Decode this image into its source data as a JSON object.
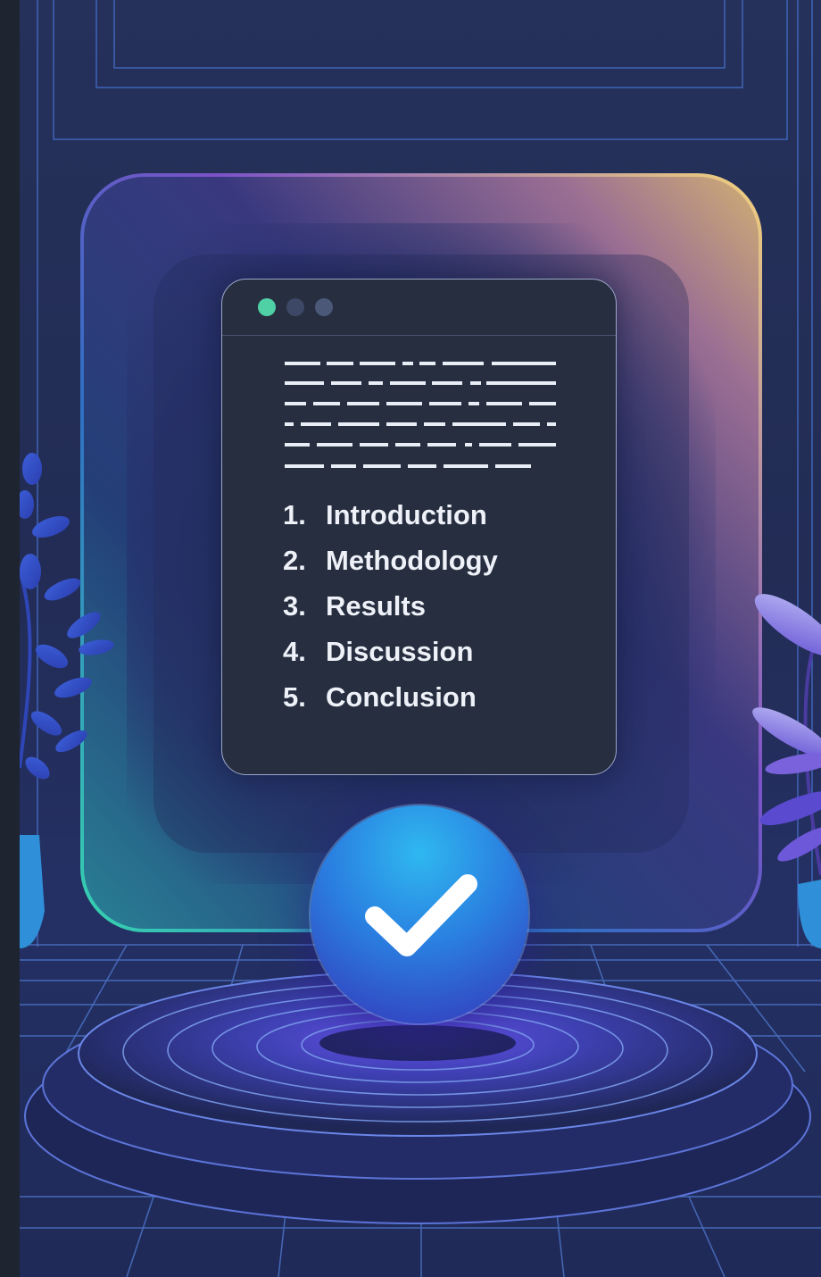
{
  "window": {
    "title_dots": [
      "green-dot",
      "gray-dot",
      "gray-dot"
    ],
    "toc": [
      {
        "number": "1.",
        "label": "Introduction"
      },
      {
        "number": "2.",
        "label": "Methodology"
      },
      {
        "number": "3.",
        "label": "Results"
      },
      {
        "number": "4.",
        "label": "Discussion"
      },
      {
        "number": "5.",
        "label": "Conclusion"
      }
    ]
  },
  "badge": {
    "icon": "checkmark-icon"
  },
  "colors": {
    "background": "#1c2433",
    "panel": "#262e3f",
    "accent_green": "#4fd1a5",
    "badge_blue": "#2a7fe0",
    "text": "#eef1f8"
  }
}
